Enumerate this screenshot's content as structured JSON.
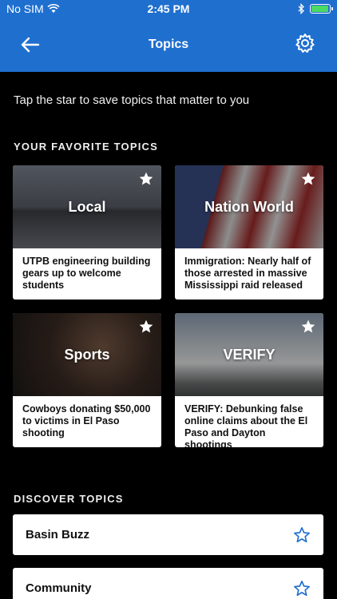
{
  "status": {
    "carrier": "No SIM",
    "time": "2:45 PM",
    "battery_level": 0.95
  },
  "nav": {
    "title": "Topics"
  },
  "intro": "Tap the star to save topics that matter to you",
  "favorites": {
    "heading": "YOUR FAVORITE TOPICS",
    "cards": [
      {
        "label": "Local",
        "headline": "UTPB engineering building gears up to welcome students",
        "starred": true
      },
      {
        "label": "Nation World",
        "headline": "Immigration: Nearly half of those arrested in massive Mississippi raid released",
        "starred": true
      },
      {
        "label": "Sports",
        "headline": "Cowboys donating $50,000 to victims in El Paso shooting",
        "starred": true
      },
      {
        "label": "VERIFY",
        "headline": "VERIFY: Debunking false online claims about the El Paso and Dayton shootings",
        "starred": true
      }
    ]
  },
  "discover": {
    "heading": "DISCOVER TOPICS",
    "topics": [
      {
        "label": "Basin Buzz",
        "starred": false
      },
      {
        "label": "Community",
        "starred": false
      }
    ]
  },
  "colors": {
    "accent": "#1f6fcf",
    "star_outline": "#1f6fcf",
    "background": "#000000"
  }
}
